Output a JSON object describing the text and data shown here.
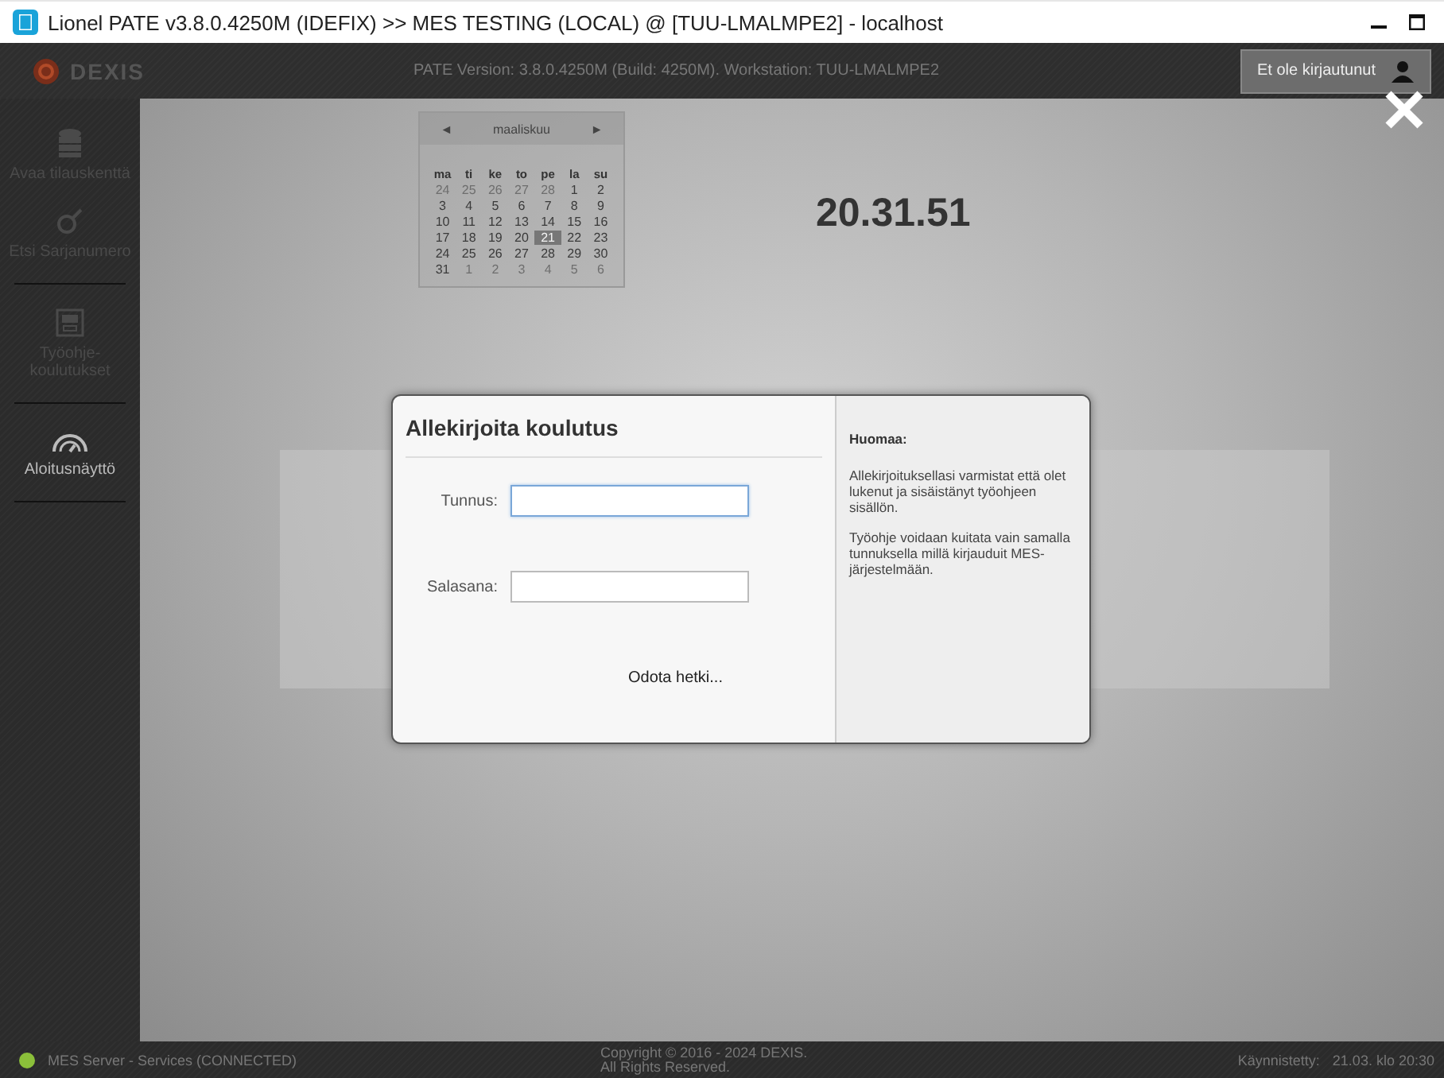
{
  "window": {
    "title": "Lionel PATE v3.8.0.4250M (IDEFIX) >> MES TESTING (LOCAL) @ [TUU-LMALMPE2] - localhost"
  },
  "header": {
    "logo": "DEXIS",
    "version": "PATE Version: 3.8.0.4250M (Build: 4250M). Workstation: TUU-LMALMPE2",
    "user_button": "Et ole kirjautunut"
  },
  "sidebar": {
    "items": [
      {
        "kind": "database",
        "label": "Avaa tilauskenttä",
        "disabled": true
      },
      {
        "kind": "search",
        "label": "Etsi Sarjanumero",
        "disabled": true
      },
      {
        "kind": "screen",
        "label": "Työohje-koulutukset",
        "disabled": true
      },
      {
        "kind": "gauge",
        "label": "Aloitusnäyttö",
        "disabled": false
      }
    ]
  },
  "calendar": {
    "month": "maaliskuu",
    "prev": "◄",
    "next": "►",
    "weekdays": [
      "ma",
      "ti",
      "ke",
      "to",
      "pe",
      "la",
      "su"
    ],
    "weeks": [
      [
        {
          "day": "24",
          "outside": true,
          "selected": false
        },
        {
          "day": "25",
          "outside": true,
          "selected": false
        },
        {
          "day": "26",
          "outside": true,
          "selected": false
        },
        {
          "day": "27",
          "outside": true,
          "selected": false
        },
        {
          "day": "28",
          "outside": true,
          "selected": false
        },
        {
          "day": "1",
          "outside": false,
          "selected": false
        },
        {
          "day": "2",
          "outside": false,
          "selected": false
        }
      ],
      [
        {
          "day": "3",
          "outside": false,
          "selected": false
        },
        {
          "day": "4",
          "outside": false,
          "selected": false
        },
        {
          "day": "5",
          "outside": false,
          "selected": false
        },
        {
          "day": "6",
          "outside": false,
          "selected": false
        },
        {
          "day": "7",
          "outside": false,
          "selected": false
        },
        {
          "day": "8",
          "outside": false,
          "selected": false
        },
        {
          "day": "9",
          "outside": false,
          "selected": false
        }
      ],
      [
        {
          "day": "10",
          "outside": false,
          "selected": false
        },
        {
          "day": "11",
          "outside": false,
          "selected": false
        },
        {
          "day": "12",
          "outside": false,
          "selected": false
        },
        {
          "day": "13",
          "outside": false,
          "selected": false
        },
        {
          "day": "14",
          "outside": false,
          "selected": false
        },
        {
          "day": "15",
          "outside": false,
          "selected": false
        },
        {
          "day": "16",
          "outside": false,
          "selected": false
        }
      ],
      [
        {
          "day": "17",
          "outside": false,
          "selected": false
        },
        {
          "day": "18",
          "outside": false,
          "selected": false
        },
        {
          "day": "19",
          "outside": false,
          "selected": false
        },
        {
          "day": "20",
          "outside": false,
          "selected": false
        },
        {
          "day": "21",
          "outside": false,
          "selected": true
        },
        {
          "day": "22",
          "outside": false,
          "selected": false
        },
        {
          "day": "23",
          "outside": false,
          "selected": false
        }
      ],
      [
        {
          "day": "24",
          "outside": false,
          "selected": false
        },
        {
          "day": "25",
          "outside": false,
          "selected": false
        },
        {
          "day": "26",
          "outside": false,
          "selected": false
        },
        {
          "day": "27",
          "outside": false,
          "selected": false
        },
        {
          "day": "28",
          "outside": false,
          "selected": false
        },
        {
          "day": "29",
          "outside": false,
          "selected": false
        },
        {
          "day": "30",
          "outside": false,
          "selected": false
        }
      ],
      [
        {
          "day": "31",
          "outside": false,
          "selected": false
        },
        {
          "day": "1",
          "outside": true,
          "selected": false
        },
        {
          "day": "2",
          "outside": true,
          "selected": false
        },
        {
          "day": "3",
          "outside": true,
          "selected": false
        },
        {
          "day": "4",
          "outside": true,
          "selected": false
        },
        {
          "day": "5",
          "outside": true,
          "selected": false
        },
        {
          "day": "6",
          "outside": true,
          "selected": false
        }
      ]
    ]
  },
  "clock": "20.31.51",
  "dialog": {
    "title": "Allekirjoita koulutus",
    "fields": [
      {
        "label": "Tunnus:",
        "focused": true
      },
      {
        "label": "Salasana:",
        "focused": false
      }
    ],
    "status": "Odota hetki...",
    "note_title": "Huomaa:",
    "notes": [
      "Allekirjoituksellasi varmistat että olet lukenut ja sisäistänyt työohjeen sisällön.",
      "Työohje voidaan kuitata vain samalla tunnuksella millä kirjauduit MES-järjestelmään."
    ]
  },
  "status_bar": {
    "server": "MES Server - Services (CONNECTED)",
    "connected": true,
    "copyright": [
      "Copyright © 2016 - 2024 DEXIS.",
      "All Rights Reserved."
    ],
    "started_label": "Käynnistetty:",
    "started": "21.03. klo 20:30"
  }
}
